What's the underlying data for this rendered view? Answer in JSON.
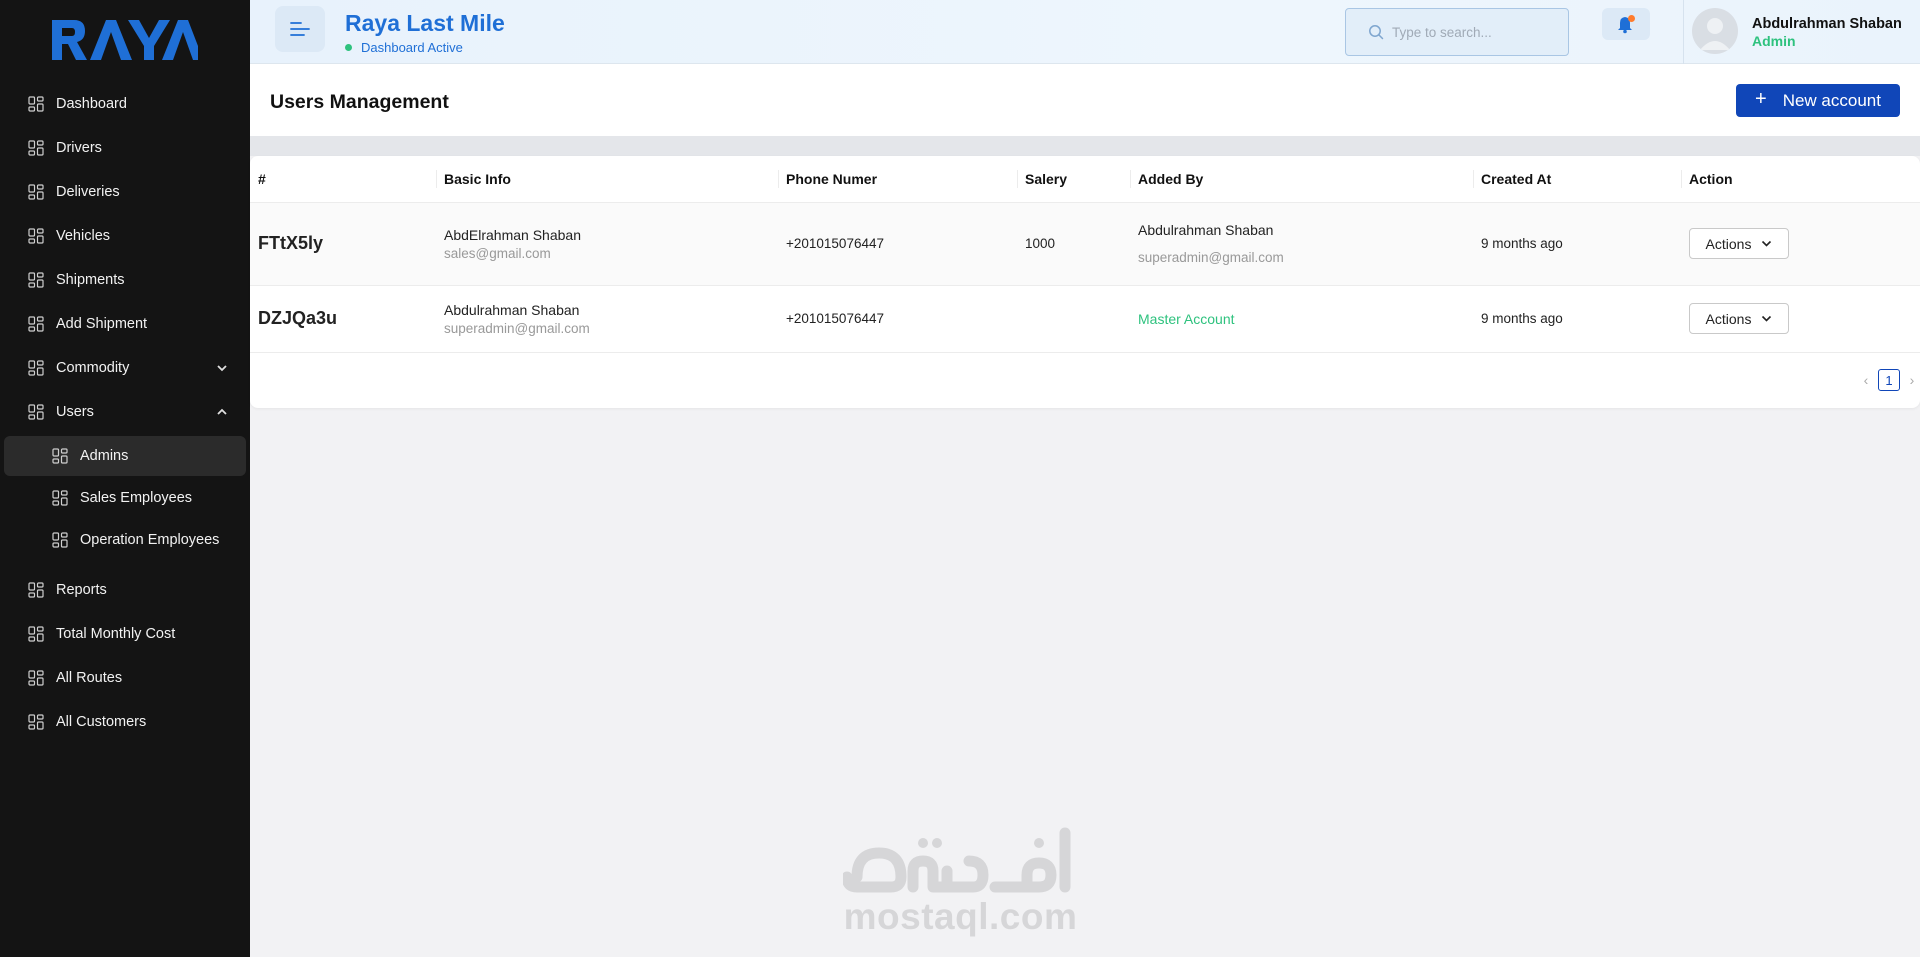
{
  "sidebar": {
    "logo_text": "RAYA",
    "items": [
      {
        "label": "Dashboard"
      },
      {
        "label": "Drivers"
      },
      {
        "label": "Deliveries"
      },
      {
        "label": "Vehicles"
      },
      {
        "label": "Shipments"
      },
      {
        "label": "Add Shipment"
      },
      {
        "label": "Commodity",
        "expanded": false
      },
      {
        "label": "Users",
        "expanded": true,
        "children": [
          {
            "label": "Admins",
            "active": true
          },
          {
            "label": "Sales Employees"
          },
          {
            "label": "Operation Employees"
          }
        ]
      },
      {
        "label": "Reports"
      },
      {
        "label": "Total Monthly Cost"
      },
      {
        "label": "All Routes"
      },
      {
        "label": "All Customers"
      }
    ]
  },
  "header": {
    "title": "Raya Last Mile",
    "status": "Dashboard Active",
    "search_placeholder": "Type to search...",
    "user_name": "Abdulrahman Shaban",
    "user_role": "Admin"
  },
  "page": {
    "title": "Users Management",
    "new_account_label": "New account"
  },
  "table": {
    "columns": [
      "#",
      "Basic Info",
      "Phone Numer",
      "Salery",
      "Added By",
      "Created At",
      "Action"
    ],
    "rows": [
      {
        "id": "FTtX5ly",
        "name": "AbdElrahman Shaban",
        "email": "sales@gmail.com",
        "phone": "+201015076447",
        "salary": "1000",
        "added_by_name": "Abdulrahman Shaban",
        "added_by_email": "superadmin@gmail.com",
        "created": "9 months ago",
        "action": "Actions"
      },
      {
        "id": "DZJQa3u",
        "name": "Abdulrahman Shaban",
        "email": "superadmin@gmail.com",
        "phone": "+201015076447",
        "salary": "",
        "added_by_name": "Master Account",
        "added_by_email": "",
        "created": "9 months ago",
        "action": "Actions"
      }
    ],
    "pagination": {
      "current_page": "1"
    }
  },
  "watermark": {
    "text": "mostaql.com",
    "arabic": "مستقل"
  },
  "colors": {
    "sidebar_bg": "#141414",
    "brand_blue": "#1f6fd6",
    "button_blue": "#1046b8",
    "status_green": "#2ec27e"
  }
}
